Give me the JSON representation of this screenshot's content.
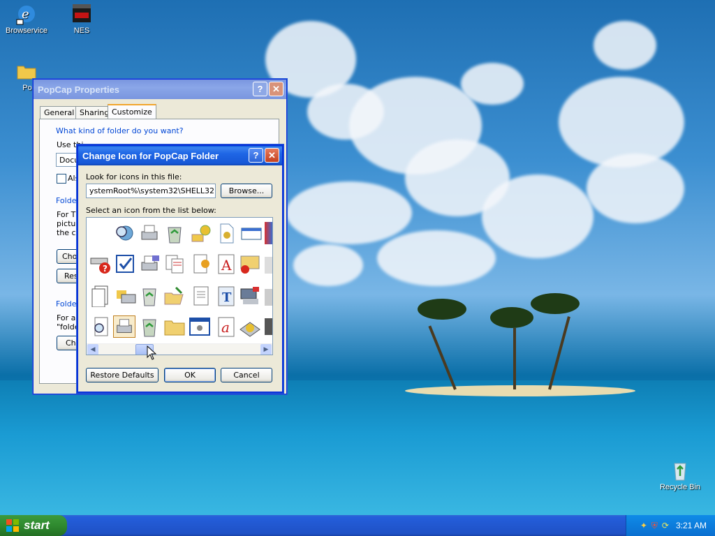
{
  "desktop": {
    "icons": [
      {
        "label": "Browservice"
      },
      {
        "label": "NES"
      },
      {
        "label": "PopC"
      },
      {
        "label": "Recycle Bin"
      }
    ]
  },
  "properties_window": {
    "title": "PopCap Properties",
    "tabs": [
      "General",
      "Sharing",
      "Customize"
    ],
    "active_tab": "Customize",
    "group1_label": "What kind of folder do you want?",
    "use_this_prefix": "Use thi",
    "template_value": "Docu",
    "also_apply_prefix": "Als",
    "group2_label": "Folder",
    "group2_line1": "For Th",
    "group2_line2": "picture",
    "group2_line3": "the co",
    "choose_btn": "Choo",
    "restore_btn": "Res",
    "group3_label": "Folder",
    "group3_line1": "For all",
    "group3_line2": "\"folde",
    "change_btn": "Cha"
  },
  "change_icon_dialog": {
    "title": "Change Icon for PopCap Folder",
    "look_label": "Look for icons in this file:",
    "file_value": "ystemRoot%\\system32\\SHELL32.dll",
    "browse_label": "Browse...",
    "select_label": "Select an icon from the list below:",
    "restore_defaults_label": "Restore Defaults",
    "ok_label": "OK",
    "cancel_label": "Cancel"
  },
  "taskbar": {
    "start_label": "start",
    "clock": "3:21 AM"
  },
  "colors": {
    "xp_blue": "#0a5ad9",
    "start_green": "#2f8a2f",
    "group_label_blue": "#0046d5"
  }
}
